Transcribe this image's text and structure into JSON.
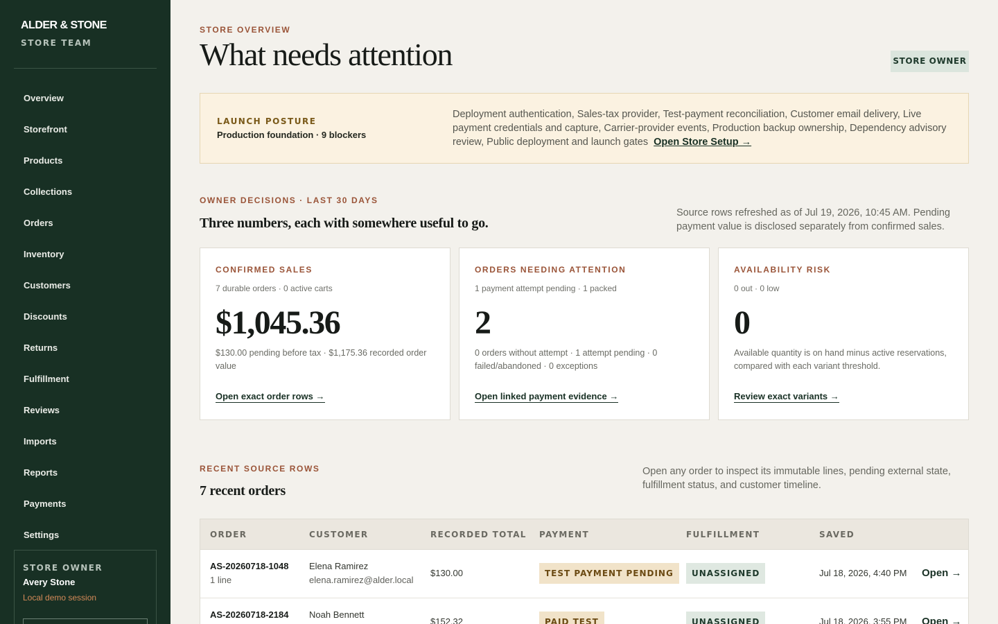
{
  "brand": {
    "name": "ALDER & STONE",
    "subtitle": "STORE TEAM"
  },
  "sidebar": {
    "items": [
      {
        "label": "Overview"
      },
      {
        "label": "Storefront"
      },
      {
        "label": "Products"
      },
      {
        "label": "Collections"
      },
      {
        "label": "Orders"
      },
      {
        "label": "Inventory"
      },
      {
        "label": "Customers"
      },
      {
        "label": "Discounts"
      },
      {
        "label": "Returns"
      },
      {
        "label": "Fulfillment"
      },
      {
        "label": "Reviews"
      },
      {
        "label": "Imports"
      },
      {
        "label": "Reports"
      },
      {
        "label": "Payments"
      },
      {
        "label": "Settings"
      }
    ],
    "account": {
      "role": "STORE OWNER",
      "name": "Avery Stone",
      "session": "Local demo session"
    }
  },
  "header": {
    "eyebrow": "STORE OVERVIEW",
    "title": "What needs attention",
    "role_chip": "STORE OWNER"
  },
  "launch": {
    "label": "LAUNCH POSTURE",
    "status": "Production foundation · 9 blockers",
    "text": "Deployment authentication, Sales-tax provider, Test-payment reconciliation, Customer email delivery, Live payment credentials and capture, Carrier-provider events, Production backup ownership, Dependency advisory review, Public deployment and launch gates",
    "link": "Open Store Setup →"
  },
  "decisions": {
    "eyebrow": "OWNER DECISIONS · LAST 30 DAYS",
    "title": "Three numbers, each with somewhere useful to go.",
    "note": "Source rows refreshed as of Jul 19, 2026, 10:45 AM. Pending payment value is disclosed separately from confirmed sales.",
    "cards": [
      {
        "label": "CONFIRMED SALES",
        "sub": "7 durable orders · 0 active carts",
        "value": "$1,045.36",
        "note": "$130.00 pending before tax · $1,175.36 recorded order value",
        "link": "Open exact order rows →"
      },
      {
        "label": "ORDERS NEEDING ATTENTION",
        "sub": "1 payment attempt pending · 1 packed",
        "value": "2",
        "note": "0 orders without attempt · 1 attempt pending · 0 failed/abandoned · 0 exceptions",
        "link": "Open linked payment evidence →"
      },
      {
        "label": "AVAILABILITY RISK",
        "sub": "0 out · 0 low",
        "value": "0",
        "note": "Available quantity is on hand minus active reservations, compared with each variant threshold.",
        "link": "Review exact variants →"
      }
    ]
  },
  "recent": {
    "eyebrow": "RECENT SOURCE ROWS",
    "title": "7 recent orders",
    "note": "Open any order to inspect its immutable lines, pending external state, fulfillment status, and customer timeline.",
    "columns": {
      "order": "ORDER",
      "customer": "CUSTOMER",
      "total": "RECORDED TOTAL",
      "payment": "PAYMENT",
      "fulfillment": "FULFILLMENT",
      "saved": "SAVED"
    },
    "rows": [
      {
        "order": "AS-20260718-1048",
        "lines": "1 line",
        "customer": "Elena Ramirez",
        "email": "elena.ramirez@alder.local",
        "total": "$130.00",
        "payment": "TEST PAYMENT PENDING",
        "fulfillment": "UNASSIGNED",
        "saved": "Jul 18, 2026, 4:40 PM",
        "open": "Open →"
      },
      {
        "order": "AS-20260718-2184",
        "lines": "",
        "customer": "Noah Bennett",
        "email": "",
        "total": "$152.32",
        "payment": "PAID TEST",
        "fulfillment": "UNASSIGNED",
        "saved": "Jul 18, 2026, 3:55 PM",
        "open": "Open →"
      }
    ]
  }
}
